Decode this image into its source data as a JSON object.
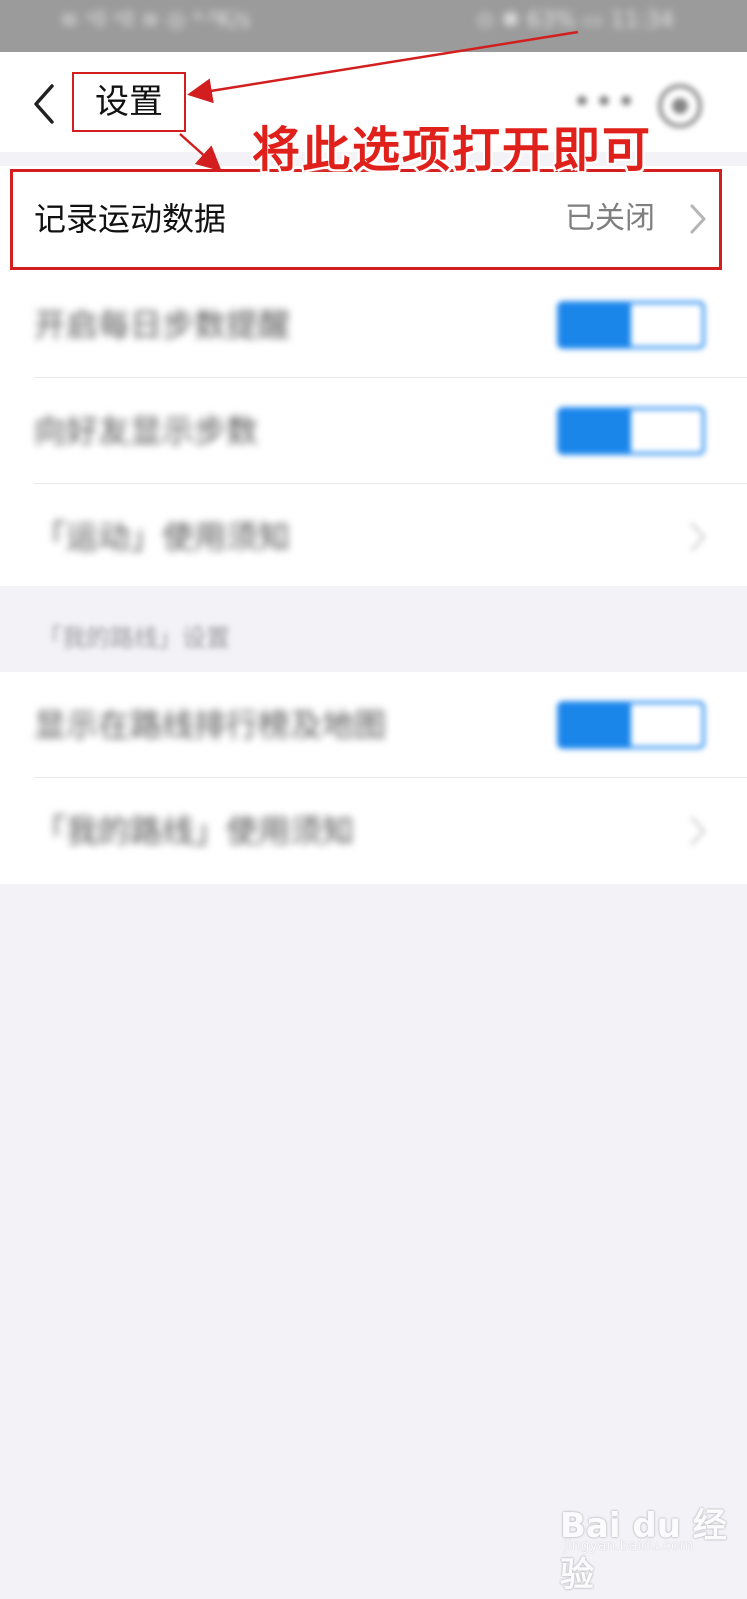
{
  "status_bar": {
    "left_text": "≋ ᵃll ᵃll ≋ ◎ ⁴·⁸K/s",
    "right_text": "⊙ ✱ 63% ▭ 11:34"
  },
  "header": {
    "title": "设置",
    "more_icon": "more-dots-icon",
    "close_icon": "capsule-close-icon"
  },
  "annotation": {
    "text": "将此选项打开即可",
    "color": "#e0201b"
  },
  "settings": {
    "record_data": {
      "label": "记录运动数据",
      "value": "已关闭"
    },
    "daily_reminder": {
      "label": "开启每日步数提醒",
      "on": true
    },
    "show_friends": {
      "label": "向好友显示步数",
      "on": true
    },
    "sport_notice": {
      "label": "「运动」使用须知"
    },
    "route_group_header": "「我的路线」设置",
    "show_in_ranking": {
      "label": "显示在路线排行榜及地图",
      "on": true
    },
    "route_notice": {
      "label": "「我的路线」使用须知"
    }
  },
  "colors": {
    "accent": "#1a86ea",
    "highlight_border": "#d21e1e",
    "background": "#f2f2f7"
  },
  "watermark": {
    "logo": "Bai du 经验",
    "url": "jingyan.baidu.com"
  }
}
